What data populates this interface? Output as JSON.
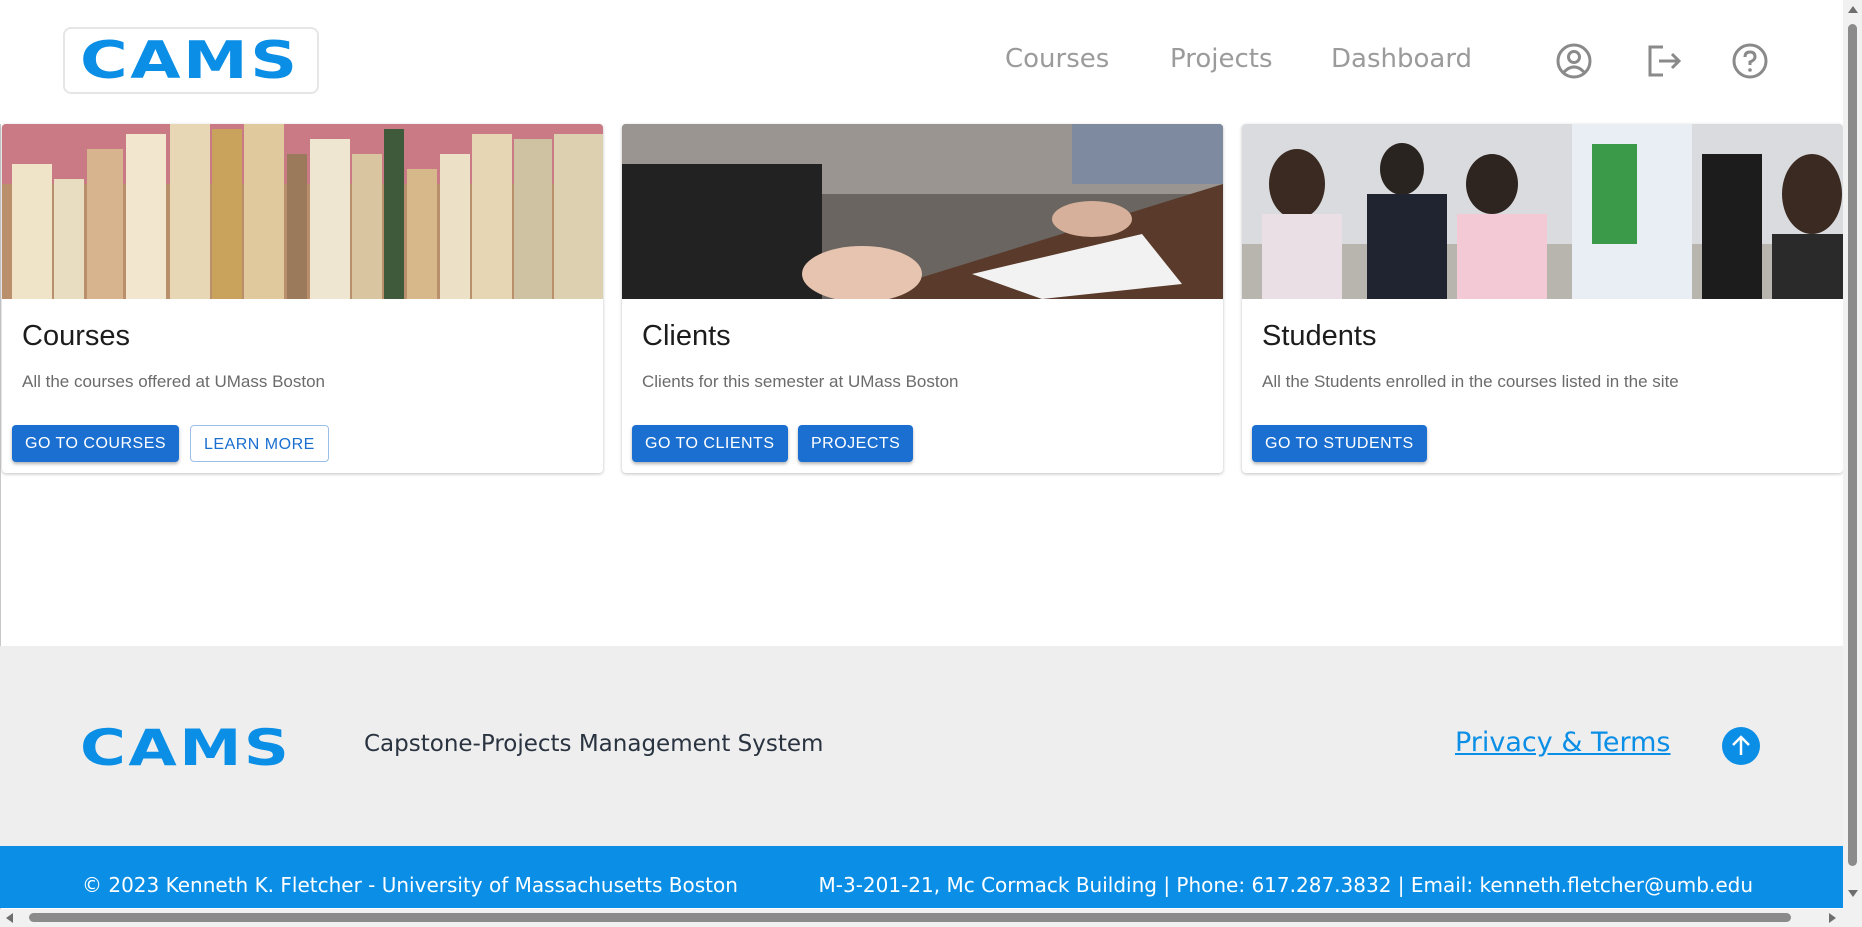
{
  "header": {
    "logo_text": "CAMS",
    "nav": {
      "courses": "Courses",
      "projects": "Projects",
      "dashboard": "Dashboard"
    },
    "icons": [
      "account-circle-icon",
      "logout-icon",
      "help-icon"
    ]
  },
  "cards": [
    {
      "title": "Courses",
      "description": "All the courses offered at UMass Boston",
      "buttons": [
        "GO TO COURSES",
        "LEARN MORE"
      ],
      "image": "books-on-shelf-photo"
    },
    {
      "title": "Clients",
      "description": "Clients for this semester at UMass Boston",
      "buttons": [
        "GO TO CLIENTS",
        "PROJECTS"
      ],
      "image": "meeting-table-photo"
    },
    {
      "title": "Students",
      "description": "All the Students enrolled in the courses listed in the site",
      "buttons": [
        "GO TO STUDENTS"
      ],
      "image": "students-in-classroom-photo"
    }
  ],
  "footer": {
    "logo_text": "CAMS",
    "tagline": "Capstone-Projects Management System",
    "privacy_link": "Privacy & Terms",
    "copyright": "© 2023 Kenneth K. Fletcher - University of Massachusetts Boston",
    "contact": "M-3-201-21, Mc Cormack Building | Phone: 617.287.3832 | Email: kenneth.fletcher@umb.edu"
  },
  "colors": {
    "brand": "#0a8ee6",
    "button": "#1a6fd1",
    "footer_bg": "#eeeeee",
    "nav_text": "#9b9b9b"
  }
}
